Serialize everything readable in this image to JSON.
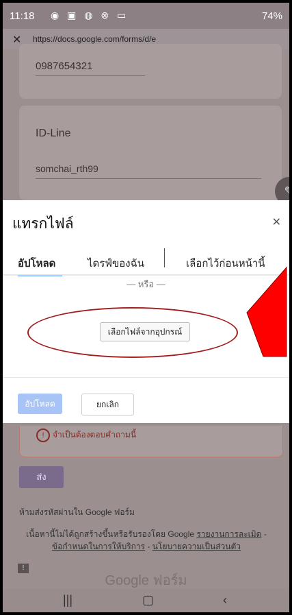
{
  "status": {
    "time": "11:18",
    "battery": "74%",
    "icons": "◉ ▣ ◍ ⊗ ▭"
  },
  "browser": {
    "url": "https://docs.google.com/forms/d/e"
  },
  "form": {
    "phone_value": "0987654321",
    "line_label": "ID-Line",
    "line_value": "somchai_rth99",
    "required_message": "จำเป็นต้องตอบคำถามนี้",
    "submit_label": "ส่ง",
    "no_password_note": "ห้ามส่งรหัสผ่านใน Google ฟอร์ม",
    "footer_line1": "เนื้อหานี้ไม่ได้ถูกสร้างขึ้นหรือรับรองโดย Google",
    "footer_report": "รายงานการละเมิด",
    "footer_terms": "ข้อกำหนดในการให้บริการ",
    "footer_privacy": "นโยบายความเป็นส่วนตัว",
    "brand": "Google ฟอร์ม"
  },
  "dialog": {
    "title": "แทรกไฟล์",
    "tabs": [
      "อัปโหลด",
      "ไดรฟ์ของฉัน",
      "เลือกไว้ก่อนหน้านี้"
    ],
    "or_text": "— หรือ —",
    "choose_file": "เลือกไฟล์จากอุปกรณ์",
    "upload_label": "อัปโหลด",
    "cancel_label": "ยกเลิก"
  },
  "colors": {
    "accent": "#4c8bf5",
    "annotation_red": "#ff0000",
    "annotation_ellipse": "#a31d1d"
  }
}
